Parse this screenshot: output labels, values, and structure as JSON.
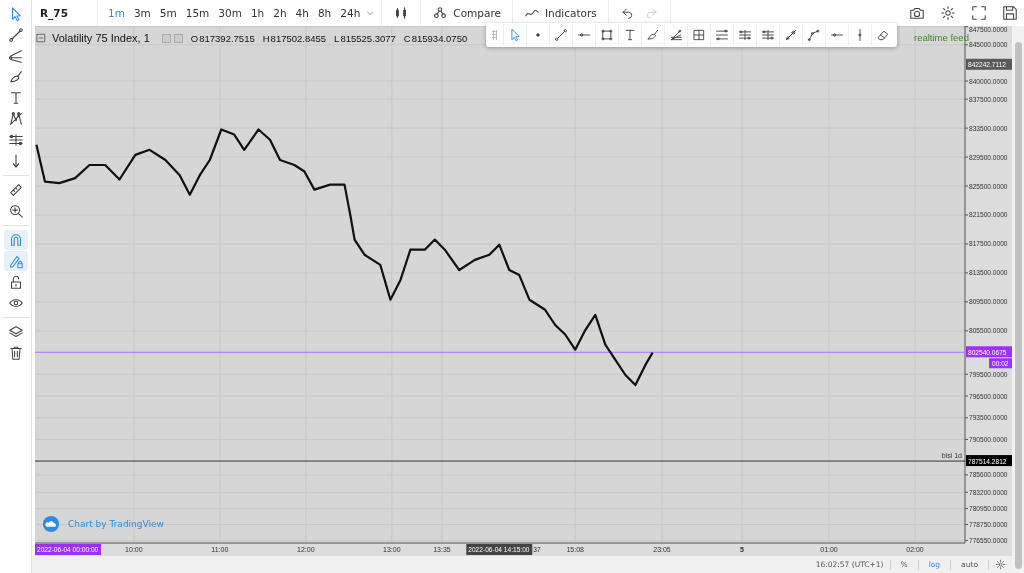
{
  "symbol": "R_75",
  "intervals": [
    {
      "label": "1m",
      "selected": true
    },
    {
      "label": "3m",
      "selected": false
    },
    {
      "label": "5m",
      "selected": false
    },
    {
      "label": "15m",
      "selected": false
    },
    {
      "label": "30m",
      "selected": false
    },
    {
      "label": "1h",
      "selected": false
    },
    {
      "label": "2h",
      "selected": false
    },
    {
      "label": "4h",
      "selected": false
    },
    {
      "label": "8h",
      "selected": false
    },
    {
      "label": "24h",
      "selected": false
    }
  ],
  "top_buttons": [
    {
      "label": "Compare",
      "kind": "compare"
    },
    {
      "label": "Indicators",
      "kind": "indicators"
    }
  ],
  "history": [
    {
      "kind": "undo",
      "disabled": false
    },
    {
      "kind": "redo",
      "disabled": true
    }
  ],
  "left_tools": [
    {
      "kind": "cursor",
      "selected": false
    },
    {
      "kind": "line",
      "selected": false
    },
    {
      "kind": "fork",
      "selected": false
    },
    {
      "kind": "brush",
      "selected": false
    },
    {
      "kind": "text",
      "selected": false
    },
    {
      "kind": "pattern",
      "selected": false
    },
    {
      "kind": "levels",
      "selected": false
    },
    {
      "kind": "arrow",
      "selected": false
    },
    {
      "kind": "ruler",
      "selected": false
    },
    {
      "kind": "zoom",
      "selected": false
    },
    {
      "kind": "magnet",
      "selected": true
    },
    {
      "kind": "lockdraw",
      "selected": true
    },
    {
      "kind": "unlock",
      "selected": false
    },
    {
      "kind": "eye",
      "selected": false
    },
    {
      "kind": "layers",
      "selected": false
    },
    {
      "kind": "trash",
      "selected": false
    }
  ],
  "float_tools": [
    {
      "kind": "cursor",
      "selected": true
    },
    {
      "kind": "dot",
      "selected": false
    },
    {
      "kind": "line",
      "selected": false
    },
    {
      "kind": "hline",
      "selected": false
    },
    {
      "kind": "rect",
      "selected": false
    },
    {
      "kind": "text",
      "selected": false
    },
    {
      "kind": "brush",
      "selected": false
    },
    {
      "kind": "fan",
      "selected": false
    },
    {
      "kind": "grid",
      "selected": false
    },
    {
      "kind": "channel",
      "selected": false
    },
    {
      "kind": "levels",
      "selected": false
    },
    {
      "kind": "levels",
      "selected": false
    },
    {
      "kind": "ray",
      "selected": false
    },
    {
      "kind": "path",
      "selected": false
    },
    {
      "kind": "hline",
      "selected": false
    },
    {
      "kind": "vline",
      "selected": false
    },
    {
      "kind": "eraser",
      "selected": false
    }
  ],
  "legend": {
    "title": "Volatility 75 Index, 1",
    "ohlc": [
      {
        "label": "O",
        "value": "817392.7515"
      },
      {
        "label": "H",
        "value": "817502.8455"
      },
      {
        "label": "L",
        "value": "815525.3077"
      },
      {
        "label": "C",
        "value": "815934.0750"
      }
    ]
  },
  "status_text": "realtime feed",
  "watermark": "Chart by TradingView",
  "price_markers": [
    {
      "kind": "high",
      "value": "842242.7112"
    },
    {
      "kind": "current",
      "value": "802540.0675",
      "timer": "00:02"
    },
    {
      "kind": "line",
      "value": "787514.2812",
      "label": "bisi 1d"
    }
  ],
  "time_labels": [
    {
      "kind": "start",
      "label": "2022-06-04 00:00:00"
    },
    {
      "kind": "cursor",
      "label": "2022-06-04 14:15:00"
    },
    {
      "kind": "partial",
      "label": "37"
    }
  ],
  "time_axis_extra": [
    {
      "label": "23:05",
      "emphasis": false
    },
    {
      "label": "5",
      "emphasis": true
    },
    {
      "label": "01:00",
      "emphasis": false
    },
    {
      "label": "02:00",
      "emphasis": false
    }
  ],
  "chart_data": {
    "type": "line",
    "grid": true,
    "xlim": [
      531,
      1180
    ],
    "ylim": [
      776200,
      847600
    ],
    "xticks": [
      {
        "value": 600,
        "label": "10:00"
      },
      {
        "value": 660,
        "label": "11:00"
      },
      {
        "value": 720,
        "label": "12:00"
      },
      {
        "value": 780,
        "label": "13:00"
      },
      {
        "value": 815,
        "label": "13:35"
      },
      {
        "value": 908,
        "label": "15:08"
      }
    ],
    "yticks": [
      {
        "value": 847500,
        "label": "847500.0000"
      },
      {
        "value": 845000,
        "label": "845000.0000"
      },
      {
        "value": 840000,
        "label": "840000.0000"
      },
      {
        "value": 837500,
        "label": "837500.0000"
      },
      {
        "value": 833500,
        "label": "833500.0000"
      },
      {
        "value": 829500,
        "label": "829500.0000"
      },
      {
        "value": 825500,
        "label": "825500.0000"
      },
      {
        "value": 821500,
        "label": "821500.0000"
      },
      {
        "value": 817500,
        "label": "817500.0000"
      },
      {
        "value": 813500,
        "label": "813500.0000"
      },
      {
        "value": 809500,
        "label": "809500.0000"
      },
      {
        "value": 805500,
        "label": "805500.0000"
      },
      {
        "value": 799500,
        "label": "799500.0000"
      },
      {
        "value": 796500,
        "label": "796500.0000"
      },
      {
        "value": 793500,
        "label": "793500.0000"
      },
      {
        "value": 790500,
        "label": "790500.0000"
      },
      {
        "value": 785600,
        "label": "785600.0000"
      },
      {
        "value": 783200,
        "label": "783200.0000"
      },
      {
        "value": 780950,
        "label": "780950.0000"
      },
      {
        "value": 778750,
        "label": "778750.0000"
      },
      {
        "value": 776550,
        "label": "776550.0000"
      }
    ],
    "ref_lines": [
      {
        "axis": "y",
        "value": 802540,
        "color": "#b070ff"
      },
      {
        "axis": "y",
        "value": 787514,
        "color": "#333333"
      }
    ],
    "x": [
      532,
      538,
      548,
      559,
      569,
      580,
      590,
      601,
      611,
      622,
      632,
      639,
      646,
      653,
      661,
      670,
      677,
      687,
      695,
      702,
      712,
      719,
      726,
      737,
      747,
      751,
      754,
      761,
      772,
      779,
      786,
      793,
      803,
      810,
      817,
      827,
      838,
      848,
      855,
      862,
      869,
      876,
      887,
      894,
      901,
      908,
      915,
      922,
      929,
      936,
      943,
      950,
      957,
      962
    ],
    "series": [
      {
        "color": "#111111",
        "values": [
          831200,
          826100,
          825900,
          826600,
          828400,
          828400,
          826400,
          829800,
          830500,
          829100,
          827000,
          824300,
          827000,
          829100,
          833300,
          832600,
          830500,
          833300,
          831900,
          829100,
          828400,
          827500,
          825000,
          825700,
          825700,
          821500,
          818100,
          816000,
          814600,
          809800,
          812500,
          816700,
          816700,
          818100,
          816700,
          813900,
          815300,
          816000,
          817400,
          813900,
          813200,
          809800,
          808400,
          806300,
          805000,
          802900,
          805600,
          807700,
          803600,
          801500,
          799400,
          798000,
          800800,
          802500
        ]
      }
    ]
  },
  "scale_info": {
    "time": "16:02:57 (UTC+1)",
    "buttons": [
      {
        "label": "%",
        "selected": false
      },
      {
        "label": "log",
        "selected": true
      },
      {
        "label": "auto",
        "selected": false
      }
    ]
  }
}
